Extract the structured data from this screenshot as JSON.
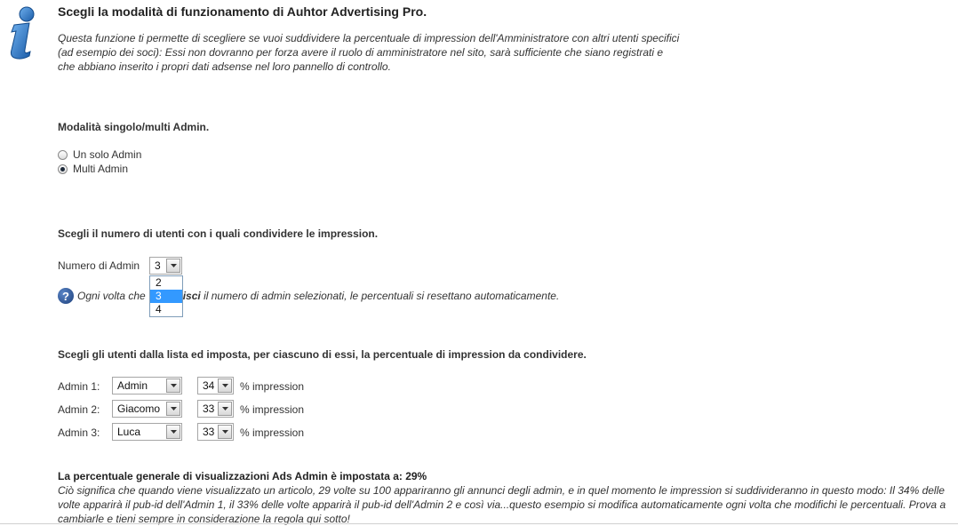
{
  "header": {
    "title": "Scegli la modalità di funzionamento di Auhtor Advertising Pro.",
    "intro": "Questa funzione ti permette di scegliere se vuoi suddividere la percentuale di impression dell'Amministratore con altri utenti specifici (ad esempio dei soci): Essi non dovranno per forza avere il ruolo di amministratore nel sito, sarà sufficiente che siano registrati e che abbiano inserito i propri dati adsense nel loro pannello di controllo."
  },
  "mode": {
    "label": "Modalità singolo/multi Admin.",
    "options": [
      {
        "label": "Un solo Admin",
        "checked": false
      },
      {
        "label": "Multi Admin",
        "checked": true
      }
    ]
  },
  "count": {
    "label": "Scegli il numero di utenti con i quali condividere le impression.",
    "field_label": "Numero di Admin",
    "value": "3",
    "dropdown_options": [
      "2",
      "3",
      "4"
    ],
    "help_prefix": "Ogni volta che",
    "help_bold": "isci",
    "help_suffix": " il numero di admin selezionati, le percentuali si resettano automaticamente."
  },
  "admins": {
    "label": "Scegli gli utenti dalla lista ed imposta, per ciascuno di essi, la percentuale di impression da condividere.",
    "suffix": "% impression",
    "rows": [
      {
        "label": "Admin 1:",
        "user": "Admin",
        "pct": "34"
      },
      {
        "label": "Admin 2:",
        "user": "Giacomo",
        "pct": "33"
      },
      {
        "label": "Admin 3:",
        "user": "Luca",
        "pct": "33"
      }
    ]
  },
  "summary": {
    "title": "La percentuale generale di visualizzazioni Ads Admin è impostata a: 29%",
    "text": "Ciò significa che quando viene visualizzato un articolo, 29 volte su 100 appariranno gli annunci degli admin, e in quel momento le impression si suddivideranno in questo modo: Il 34% delle volte apparirà il pub-id dell'Admin 1, il 33% delle volte apparirà il pub-id dell'Admin 2 e così via...questo esempio si modifica automaticamente ogni volta che modifichi le percentuali. Prova a cambiarle e tieni sempre in considerazione la regola qui sotto!"
  },
  "colors": {
    "accent": "#3399ff",
    "info_icon": "#1d5fae"
  }
}
